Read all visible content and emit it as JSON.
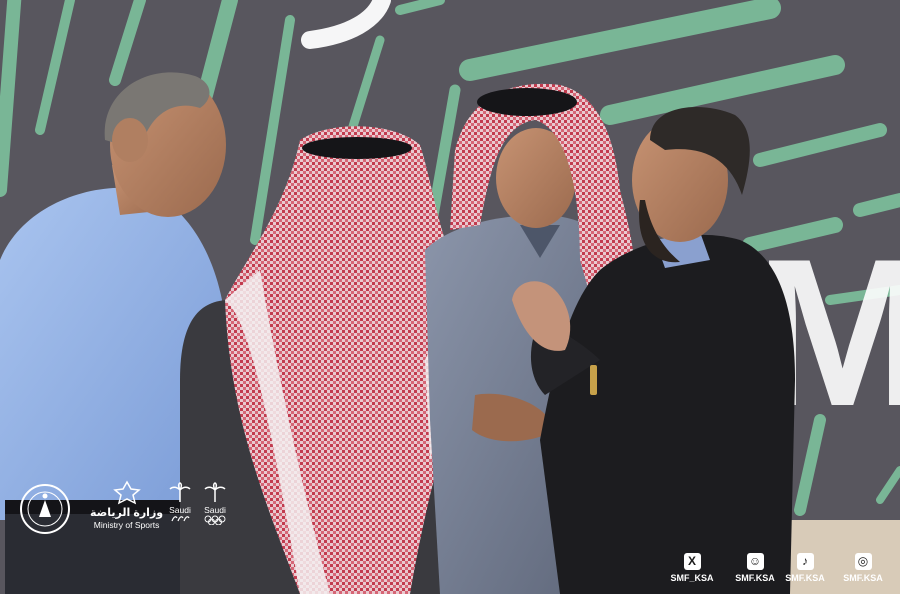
{
  "backdrop": {
    "partial_text": "M"
  },
  "branding": {
    "federation_emblem": "saudi-federation-seal",
    "ministry": {
      "name_ar": "وزارة الرياضة",
      "name_en": "Ministry of Sports"
    },
    "paralympic": {
      "label": "Saudi"
    },
    "olympic": {
      "label": "Saudi"
    }
  },
  "social": [
    {
      "platform": "x",
      "icon": "x-icon",
      "glyph": "X",
      "handle": "SMF_KSA"
    },
    {
      "platform": "snapchat",
      "icon": "snapchat-icon",
      "glyph": "☺",
      "handle": "SMF.KSA"
    },
    {
      "platform": "tiktok",
      "icon": "tiktok-icon",
      "glyph": "♪",
      "handle": "SMF.KSA"
    },
    {
      "platform": "instagram",
      "icon": "instagram-icon",
      "glyph": "◎",
      "handle": "SMF.KSA"
    }
  ],
  "colors": {
    "shemagh_red": "#c23b4e",
    "backdrop_green": "#7fc7a0",
    "suit_black": "#1c1c1f"
  }
}
